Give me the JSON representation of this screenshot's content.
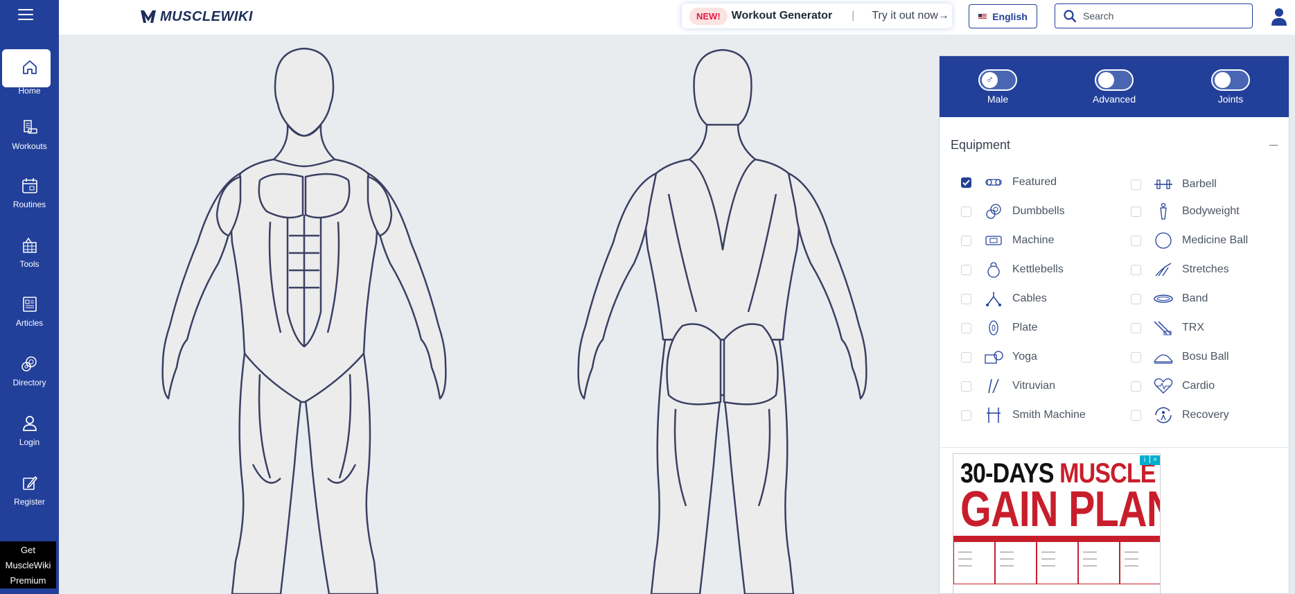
{
  "app": {
    "brand": "MUSCLEWIKI"
  },
  "sidebar": {
    "items": [
      {
        "label": "Home",
        "icon": "home-icon"
      },
      {
        "label": "Workouts",
        "icon": "workouts-icon"
      },
      {
        "label": "Routines",
        "icon": "calendar-icon"
      },
      {
        "label": "Tools",
        "icon": "tools-icon"
      },
      {
        "label": "Articles",
        "icon": "articles-icon"
      },
      {
        "label": "Directory",
        "icon": "directory-icon"
      },
      {
        "label": "Login",
        "icon": "user-icon"
      },
      {
        "label": "Register",
        "icon": "edit-icon"
      }
    ],
    "premium": {
      "line1": "Get",
      "line2": "MuscleWiki",
      "line3": "Premium"
    }
  },
  "header": {
    "promo": {
      "badge": "NEW!",
      "title": "Workout Generator",
      "separator": "|",
      "cta": "Try it out now→"
    },
    "language": "English",
    "search": {
      "placeholder": "Search",
      "value": ""
    }
  },
  "panel": {
    "toggles": [
      {
        "label": "Male",
        "knob": "♂"
      },
      {
        "label": "Advanced",
        "knob": ""
      },
      {
        "label": "Joints",
        "knob": ""
      }
    ],
    "equipment_title": "Equipment",
    "equipment": [
      {
        "label": "Featured",
        "checked": true
      },
      {
        "label": "Barbell",
        "checked": false
      },
      {
        "label": "Dumbbells",
        "checked": false
      },
      {
        "label": "Bodyweight",
        "checked": false
      },
      {
        "label": "Machine",
        "checked": false
      },
      {
        "label": "Medicine Ball",
        "checked": false
      },
      {
        "label": "Kettlebells",
        "checked": false
      },
      {
        "label": "Stretches",
        "checked": false
      },
      {
        "label": "Cables",
        "checked": false
      },
      {
        "label": "Band",
        "checked": false
      },
      {
        "label": "Plate",
        "checked": false
      },
      {
        "label": "TRX",
        "checked": false
      },
      {
        "label": "Yoga",
        "checked": false
      },
      {
        "label": "Bosu Ball",
        "checked": false
      },
      {
        "label": "Vitruvian",
        "checked": false
      },
      {
        "label": "Cardio",
        "checked": false
      },
      {
        "label": "Smith Machine",
        "checked": false
      },
      {
        "label": "Recovery",
        "checked": false
      }
    ]
  },
  "ad": {
    "line1_black": "30-DAYS ",
    "line1_red": "MUSCLE",
    "line2": "GAIN PLAN"
  },
  "colors": {
    "brand_blue": "#22409a",
    "figure_fill": "#ececec",
    "figure_stroke": "#3b3f63",
    "ad_red": "#c81e2b"
  }
}
